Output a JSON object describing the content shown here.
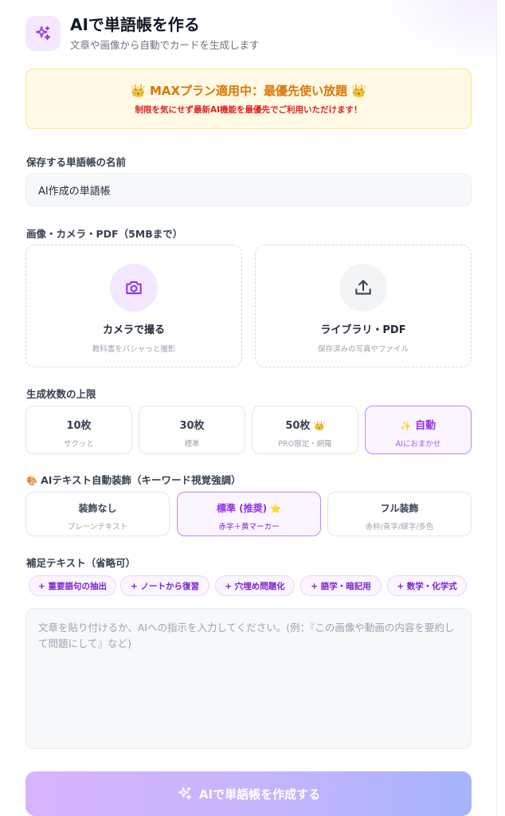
{
  "header": {
    "title": "AIで単語帳を作る",
    "subtitle": "文章や画像から自動でカードを生成します",
    "icon": "sparkles-icon"
  },
  "banner": {
    "crown_left": "👑",
    "title": "MAXプラン適用中：最優先使い放題",
    "crown_right": "👑",
    "subtitle": "制限を気にせず最新AI機能を最優先でご利用いただけます！"
  },
  "deck_name": {
    "label": "保存する単語帳の名前",
    "value": "AI作成の単語帳"
  },
  "upload": {
    "label": "画像・カメラ・PDF（5MBまで）",
    "camera": {
      "title": "カメラで撮る",
      "sub": "教科書をパシャっと撮影",
      "icon": "camera-icon"
    },
    "library": {
      "title": "ライブラリ・PDF",
      "sub": "保存済みの写真やファイル",
      "icon": "upload-icon"
    }
  },
  "limit": {
    "label": "生成枚数の上限",
    "options": [
      {
        "label": "10枚",
        "sub": "サクッと"
      },
      {
        "label": "30枚",
        "sub": "標準"
      },
      {
        "label": "50枚",
        "badge": "👑",
        "sub": "PRO限定・網羅"
      },
      {
        "prefix": "✨",
        "label": "自動",
        "sub": "AIにおまかせ",
        "selected": true
      }
    ]
  },
  "decoration": {
    "emoji": "🎨",
    "label": "AIテキスト自動装飾（キーワード視覚強調）",
    "options": [
      {
        "label": "装飾なし",
        "sub": "プレーンテキスト"
      },
      {
        "label": "標準 (推奨)",
        "badge": "⭐",
        "sub": "赤字＋黄マーカー",
        "selected": true
      },
      {
        "label": "フル装飾",
        "sub": "赤枠/青字/緑字/多色"
      }
    ]
  },
  "supplement": {
    "label": "補足テキスト（省略可）",
    "chips": [
      "+ 重要語句の抽出",
      "+ ノートから復習",
      "+ 穴埋め問題化",
      "+ 語学・暗記用",
      "+ 数学・化学式"
    ],
    "placeholder": "文章を貼り付けるか、AIへの指示を入力してください。(例：『この画像や動画の内容を要約して問題にして』など)"
  },
  "submit": {
    "label": "AIで単語帳を作成する",
    "icon": "sparkles-icon"
  },
  "colors": {
    "accent": "#9333ea",
    "banner_bg": "#fff9e6",
    "banner_title": "#d97706",
    "banner_sub": "#dc2626"
  }
}
